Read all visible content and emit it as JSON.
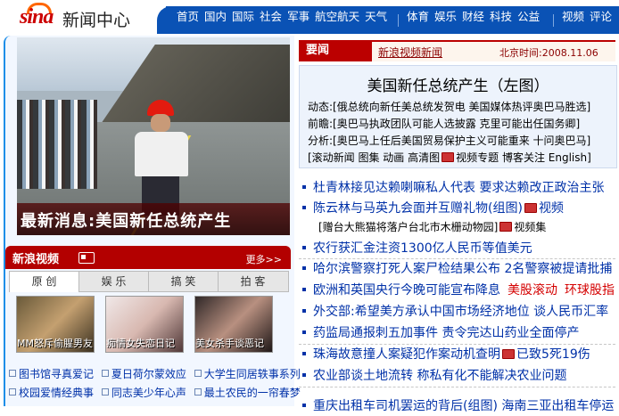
{
  "header": {
    "logo_text": "sina",
    "site_section": "新闻中心",
    "nav_group_1": [
      "首页",
      "国内",
      "国际",
      "社会",
      "军事",
      "航空航天",
      "天气"
    ],
    "nav_group_2": [
      "体育",
      "娱乐",
      "财经",
      "科技",
      "公益"
    ],
    "nav_group_3": [
      "视频",
      "评论"
    ]
  },
  "hero": {
    "caption": "最新消息:美国新任总统产生"
  },
  "video": {
    "title": "新浪视频",
    "more": "更多>>",
    "tabs": [
      "原 创",
      "娱 乐",
      "搞 笑",
      "拍 客"
    ],
    "thumbs": [
      "MM怒斥偷腥男友",
      "痴情女失恋日记",
      "美女杀手谈恶记"
    ],
    "list_row1": [
      "图书馆寻真爱记",
      "夏日荷尔蒙效应",
      "大学生同居轶事系列"
    ],
    "list_row2": [
      "校园爱情经典事",
      "同志美少年心声",
      "最土农民的一帘春梦"
    ]
  },
  "news": {
    "tab_label": "要闻",
    "video_news_link": "新浪视频新闻",
    "time_label": "北京时间:",
    "time_value": "2008.11.06",
    "top_headline": "美国新任总统产生（左图）",
    "dongtai": "动态:[俄总统向新任美总统发贺电  美国媒体热评奥巴马胜选]",
    "qianzhan": "前瞻:[奥巴马执政团队可能人选披露  克里可能出任国务卿]",
    "fenxi": "分析:[奥巴马上任后美国贸易保护主义可能重来  十问奥巴马]",
    "links_row_a": "[滚动新闻  图集  动画  高清图",
    "links_row_b": "视频专题  博客关注  English]",
    "headlines": [
      {
        "text": "杜青林接见达赖喇嘛私人代表  要求达赖改正政治主张"
      },
      {
        "text": "陈云林与马英九会面并互赠礼物(组图)",
        "extra": "视频"
      },
      {
        "sub": "[赠台大熊猫将落户台北市木栅动物园]",
        "sub_extra": "视频集"
      },
      {
        "text": "农行获汇金注资1300亿人民币等值美元"
      },
      {
        "text": "哈尔滨警察打死人案尸检结果公布  2名警察被提请批捕"
      },
      {
        "text": "欧洲和英国央行今晚可能宣布降息",
        "red1": "美股滚动",
        "red2": "环球股指"
      },
      {
        "text": "外交部:希望美方承认中国市场经济地位  谈人民币汇率"
      },
      {
        "text": "药监局通报刺五加事件  责令完达山药业全面停产"
      },
      {
        "text": "珠海故意撞人案疑犯作案动机查明",
        "extra": "已致5死19伤"
      },
      {
        "text": "农业部谈土地流转  称私有化不能解决农业问题"
      },
      {
        "text": "重庆出租车司机罢运的背后(组图)  海南三亚出租车停运"
      }
    ]
  },
  "colors": {
    "nav_blue": "#0a52b5",
    "news_red": "#b00000",
    "link_blue": "#0031a8"
  }
}
